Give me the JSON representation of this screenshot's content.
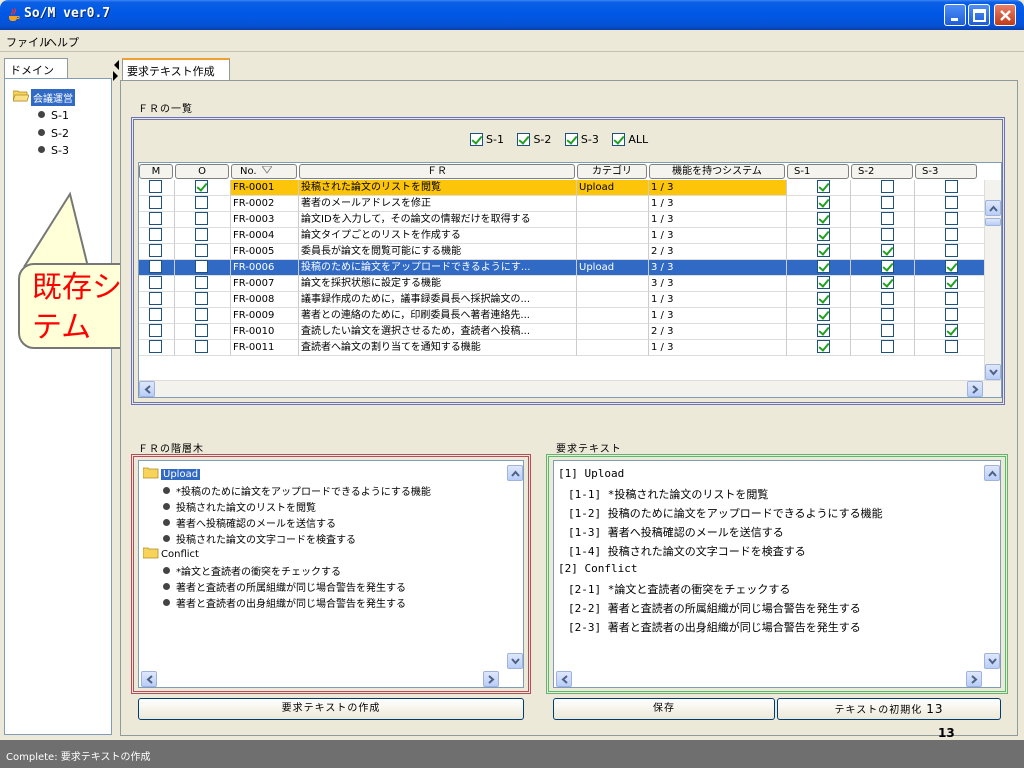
{
  "window": {
    "title": "So/M  ver0.7"
  },
  "menu": [
    "ファイル",
    "ヘルプ"
  ],
  "domain": {
    "tab_label": "ドメイン",
    "root_label": "会議運営",
    "nodes": [
      "S-1",
      "S-2",
      "S-3"
    ]
  },
  "callout": {
    "text": "既存システム"
  },
  "main_tab_label": "要求テキスト作成",
  "fr_list": {
    "section_label": "ＦＲの一覧",
    "filters": [
      {
        "label": "S-1",
        "checked": true
      },
      {
        "label": "S-2",
        "checked": true
      },
      {
        "label": "S-3",
        "checked": true
      },
      {
        "label": "ALL",
        "checked": true
      }
    ],
    "columns": [
      "M",
      "O",
      "No.",
      "ＦＲ",
      "カテゴリ",
      "機能を持つシステム",
      "S-1",
      "S-2",
      "S-3"
    ],
    "rows": [
      {
        "m": false,
        "o": true,
        "no": "FR-0001",
        "fr": "投稿された論文のリストを閲覧",
        "cat": "Upload",
        "sys": "1 / 3",
        "s1": true,
        "s2": false,
        "s3": false,
        "sel": "orange"
      },
      {
        "m": false,
        "o": false,
        "no": "FR-0002",
        "fr": "著者のメールアドレスを修正",
        "cat": "",
        "sys": "1 / 3",
        "s1": true,
        "s2": false,
        "s3": false,
        "sel": ""
      },
      {
        "m": false,
        "o": false,
        "no": "FR-0003",
        "fr": "論文IDを入力して，その論文の情報だけを取得する",
        "cat": "",
        "sys": "1 / 3",
        "s1": true,
        "s2": false,
        "s3": false,
        "sel": ""
      },
      {
        "m": false,
        "o": false,
        "no": "FR-0004",
        "fr": "論文タイプごとのリストを作成する",
        "cat": "",
        "sys": "1 / 3",
        "s1": true,
        "s2": false,
        "s3": false,
        "sel": ""
      },
      {
        "m": false,
        "o": false,
        "no": "FR-0005",
        "fr": "委員長が論文を閲覧可能にする機能",
        "cat": "",
        "sys": "2 / 3",
        "s1": true,
        "s2": true,
        "s3": false,
        "sel": ""
      },
      {
        "m": false,
        "o": false,
        "no": "FR-0006",
        "fr": "投稿のために論文をアップロードできるようにす...",
        "cat": "Upload",
        "sys": "3 / 3",
        "s1": true,
        "s2": true,
        "s3": true,
        "sel": "blue"
      },
      {
        "m": false,
        "o": false,
        "no": "FR-0007",
        "fr": "論文を採択状態に設定する機能",
        "cat": "",
        "sys": "3 / 3",
        "s1": true,
        "s2": true,
        "s3": true,
        "sel": ""
      },
      {
        "m": false,
        "o": false,
        "no": "FR-0008",
        "fr": "議事録作成のために，議事録委員長へ採択論文の...",
        "cat": "",
        "sys": "1 / 3",
        "s1": true,
        "s2": false,
        "s3": false,
        "sel": ""
      },
      {
        "m": false,
        "o": false,
        "no": "FR-0009",
        "fr": "著者との連絡のために，印刷委員長へ著者連絡先...",
        "cat": "",
        "sys": "1 / 3",
        "s1": true,
        "s2": false,
        "s3": false,
        "sel": ""
      },
      {
        "m": false,
        "o": false,
        "no": "FR-0010",
        "fr": "査読したい論文を選択させるため，査読者へ投稿...",
        "cat": "",
        "sys": "2 / 3",
        "s1": true,
        "s2": false,
        "s3": true,
        "sel": ""
      },
      {
        "m": false,
        "o": false,
        "no": "FR-0011",
        "fr": "査読者へ論文の割り当てを通知する機能",
        "cat": "",
        "sys": "1 / 3",
        "s1": true,
        "s2": false,
        "s3": false,
        "sel": ""
      }
    ]
  },
  "fr_tree": {
    "section_label": "ＦＲの階層木",
    "groups": [
      {
        "label": "Upload",
        "selected": true,
        "items": [
          "*投稿のために論文をアップロードできるようにする機能",
          "投稿された論文のリストを閲覧",
          "著者へ投稿確認のメールを送信する",
          "投稿された論文の文字コードを検査する"
        ]
      },
      {
        "label": "Conflict",
        "selected": false,
        "items": [
          "*論文と査読者の衝突をチェックする",
          "著者と査読者の所属組織が同じ場合警告を発生する",
          "著者と査読者の出身組織が同じ場合警告を発生する"
        ]
      }
    ],
    "button_label": "要求テキストの作成"
  },
  "req_text": {
    "section_label": "要求テキスト",
    "lines": [
      "[1] Upload",
      "[1-1] *投稿された論文のリストを閲覧",
      "[1-2] 投稿のために論文をアップロードできるようにする機能",
      "[1-3] 著者へ投稿確認のメールを送信する",
      "[1-4] 投稿された論文の文字コードを検査する",
      "[2] Conflict",
      "[2-1] *論文と査読者の衝突をチェックする",
      "[2-2] 著者と査読者の所属組織が同じ場合警告を発生する",
      "[2-3] 著者と査読者の出身組織が同じ場合警告を発生する"
    ],
    "save_label": "保存",
    "reset_label": "テキストの初期化",
    "reset_suffix": "13"
  },
  "status": {
    "text": "Complete: 要求テキストの作成"
  },
  "page_number": "13",
  "colors": {
    "title_blue": "#0058e6",
    "selection_blue": "#316ac5",
    "highlight_orange": "#fdc50a",
    "callout_text": "#ff0000",
    "callout_bg": "#ffffd8",
    "check_green": "#21a121"
  }
}
